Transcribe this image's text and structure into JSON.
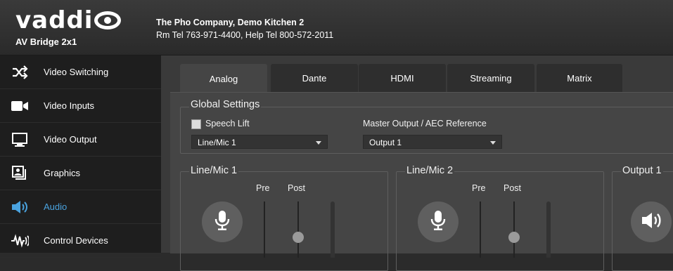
{
  "header": {
    "brand": "vaddi",
    "product": "AV Bridge 2x1",
    "room_name": "The Pho Company, Demo Kitchen 2",
    "room_phone": "Rm Tel 763-971-4400, Help Tel 800-572-2011"
  },
  "sidebar": {
    "items": [
      {
        "label": "Video Switching",
        "icon": "shuffle-icon"
      },
      {
        "label": "Video Inputs",
        "icon": "video-camera-icon"
      },
      {
        "label": "Video Output",
        "icon": "monitor-icon"
      },
      {
        "label": "Graphics",
        "icon": "graphics-icon"
      },
      {
        "label": "Audio",
        "icon": "speaker-icon",
        "active": true
      },
      {
        "label": "Control Devices",
        "icon": "control-devices-icon"
      }
    ]
  },
  "tabs": [
    "Analog",
    "Dante",
    "HDMI",
    "Streaming",
    "Matrix"
  ],
  "active_tab": "Analog",
  "global_settings": {
    "title": "Global Settings",
    "speech_lift_label": "Speech Lift",
    "speech_lift_checked": false,
    "input_select_value": "Line/Mic 1",
    "master_output_label": "Master Output / AEC Reference",
    "master_output_value": "Output 1"
  },
  "channels": [
    {
      "title": "Line/Mic 1",
      "pre_label": "Pre",
      "post_label": "Post",
      "icon": "microphone-icon"
    },
    {
      "title": "Line/Mic 2",
      "pre_label": "Pre",
      "post_label": "Post",
      "icon": "microphone-icon"
    },
    {
      "title": "Output 1",
      "icon": "speaker-icon"
    }
  ],
  "colors": {
    "accent": "#4aa3df",
    "sidebar_bg": "#1e1e1e",
    "panel_bg": "#454545"
  }
}
